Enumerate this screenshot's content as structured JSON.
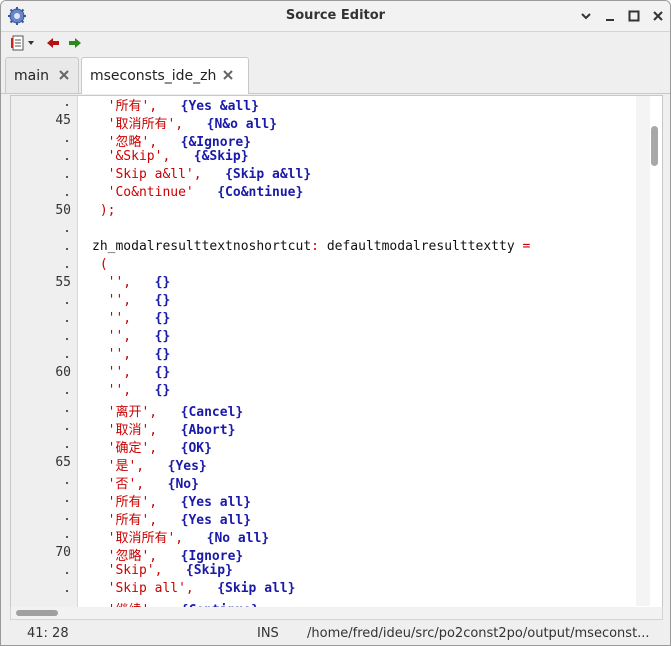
{
  "window": {
    "title": "Source Editor"
  },
  "tabs": [
    {
      "label": "main",
      "active": false
    },
    {
      "label": "mseconsts_ide_zh",
      "active": true
    }
  ],
  "gutter": [
    ".",
    "45",
    ".",
    ".",
    ".",
    ".",
    "50",
    ".",
    ".",
    ".",
    "55",
    ".",
    ".",
    ".",
    ".",
    "60",
    ".",
    ".",
    ".",
    ".",
    "65",
    ".",
    ".",
    ".",
    ".",
    "70",
    ".",
    "."
  ],
  "lines": [
    [
      {
        "t": "  '所有',   ",
        "c": "str"
      },
      {
        "t": "{Yes &all}",
        "c": "kw"
      }
    ],
    [
      {
        "t": "  '取消所有',   ",
        "c": "str"
      },
      {
        "t": "{N&o all}",
        "c": "kw"
      }
    ],
    [
      {
        "t": "  '忽略',   ",
        "c": "str"
      },
      {
        "t": "{&Ignore}",
        "c": "kw"
      }
    ],
    [
      {
        "t": "  '&Skip',   ",
        "c": "str"
      },
      {
        "t": "{&Skip}",
        "c": "kw"
      }
    ],
    [
      {
        "t": "  'Skip a&ll',   ",
        "c": "str"
      },
      {
        "t": "{Skip a&ll}",
        "c": "kw"
      }
    ],
    [
      {
        "t": "  'Co&ntinue'   ",
        "c": "str"
      },
      {
        "t": "{Co&ntinue}",
        "c": "kw"
      }
    ],
    [
      {
        "t": " );",
        "c": "sym"
      }
    ],
    [
      {
        "t": "",
        "c": "id"
      }
    ],
    [
      {
        "t": "zh_modalresulttextnoshortcut",
        "c": "id"
      },
      {
        "t": ": ",
        "c": "sym"
      },
      {
        "t": "defaultmodalresulttextty",
        "c": "id"
      },
      {
        "t": " =",
        "c": "sym"
      }
    ],
    [
      {
        "t": " (",
        "c": "sym"
      }
    ],
    [
      {
        "t": "  '',   ",
        "c": "str"
      },
      {
        "t": "{}",
        "c": "kw"
      }
    ],
    [
      {
        "t": "  '',   ",
        "c": "str"
      },
      {
        "t": "{}",
        "c": "kw"
      }
    ],
    [
      {
        "t": "  '',   ",
        "c": "str"
      },
      {
        "t": "{}",
        "c": "kw"
      }
    ],
    [
      {
        "t": "  '',   ",
        "c": "str"
      },
      {
        "t": "{}",
        "c": "kw"
      }
    ],
    [
      {
        "t": "  '',   ",
        "c": "str"
      },
      {
        "t": "{}",
        "c": "kw"
      }
    ],
    [
      {
        "t": "  '',   ",
        "c": "str"
      },
      {
        "t": "{}",
        "c": "kw"
      }
    ],
    [
      {
        "t": "  '',   ",
        "c": "str"
      },
      {
        "t": "{}",
        "c": "kw"
      }
    ],
    [
      {
        "t": "  '离开',   ",
        "c": "str"
      },
      {
        "t": "{Cancel}",
        "c": "kw"
      }
    ],
    [
      {
        "t": "  '取消',   ",
        "c": "str"
      },
      {
        "t": "{Abort}",
        "c": "kw"
      }
    ],
    [
      {
        "t": "  '确定',   ",
        "c": "str"
      },
      {
        "t": "{OK}",
        "c": "kw"
      }
    ],
    [
      {
        "t": "  '是',   ",
        "c": "str"
      },
      {
        "t": "{Yes}",
        "c": "kw"
      }
    ],
    [
      {
        "t": "  '否',   ",
        "c": "str"
      },
      {
        "t": "{No}",
        "c": "kw"
      }
    ],
    [
      {
        "t": "  '所有',   ",
        "c": "str"
      },
      {
        "t": "{Yes all}",
        "c": "kw"
      }
    ],
    [
      {
        "t": "  '所有',   ",
        "c": "str"
      },
      {
        "t": "{Yes all}",
        "c": "kw"
      }
    ],
    [
      {
        "t": "  '取消所有',   ",
        "c": "str"
      },
      {
        "t": "{No all}",
        "c": "kw"
      }
    ],
    [
      {
        "t": "  '忽略',   ",
        "c": "str"
      },
      {
        "t": "{Ignore}",
        "c": "kw"
      }
    ],
    [
      {
        "t": "  'Skip',   ",
        "c": "str"
      },
      {
        "t": "{Skip}",
        "c": "kw"
      }
    ],
    [
      {
        "t": "  'Skip all',   ",
        "c": "str"
      },
      {
        "t": "{Skip all}",
        "c": "kw"
      }
    ],
    [
      {
        "t": "  '继续',   ",
        "c": "str"
      },
      {
        "t": "{Continue}",
        "c": "kw"
      }
    ]
  ],
  "status": {
    "position": "41: 28",
    "mode": "INS",
    "path": "/home/fred/ideu/src/po2const2po/output/mseconst..."
  },
  "colors": {
    "string": "#cc0000",
    "keyword": "#1a1aaa"
  }
}
